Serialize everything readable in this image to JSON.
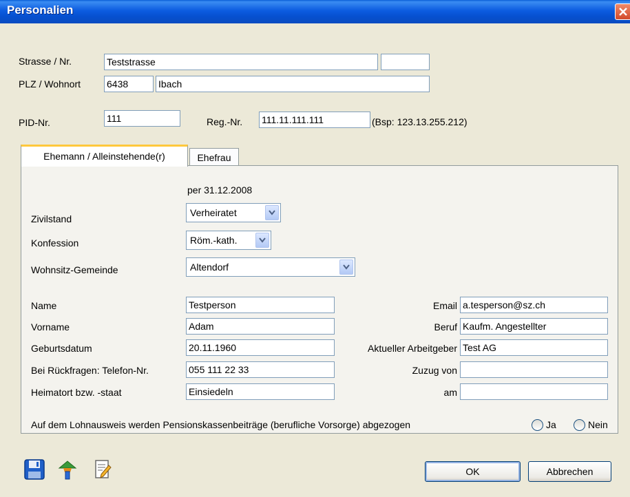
{
  "window": {
    "title": "Personalien"
  },
  "address": {
    "street_label": "Strasse / Nr.",
    "street_value": "Teststrasse",
    "number_value": "",
    "plz_label": "PLZ / Wohnort",
    "plz_value": "6438",
    "city_value": "Ibach"
  },
  "ids": {
    "pid_label": "PID-Nr.",
    "pid_value": "111",
    "reg_label": "Reg.-Nr.",
    "reg_value": "111.11.111.111",
    "reg_hint": "(Bsp: 123.13.255.212)"
  },
  "tabs": [
    {
      "label": "Ehemann / Alleinstehende(r)",
      "active": true
    },
    {
      "label": "Ehefrau",
      "active": false
    }
  ],
  "panel": {
    "date_text": "per 31.12.2008",
    "zivilstand_label": "Zivilstand",
    "zivilstand_value": "Verheiratet",
    "konfession_label": "Konfession",
    "konfession_value": "Röm.-kath.",
    "gemeinde_label": "Wohnsitz-Gemeinde",
    "gemeinde_value": "Altendorf",
    "name_label": "Name",
    "name_value": "Testperson",
    "vorname_label": "Vorname",
    "vorname_value": "Adam",
    "geburtsdatum_label": "Geburtsdatum",
    "geburtsdatum_value": "20.11.1960",
    "telefon_label": "Bei Rückfragen: Telefon-Nr.",
    "telefon_value": "055 111 22 33",
    "heimatort_label": "Heimatort bzw. -staat",
    "heimatort_value": "Einsiedeln",
    "email_label": "Email",
    "email_value": "a.tesperson@sz.ch",
    "beruf_label": "Beruf",
    "beruf_value": "Kaufm. Angestellter",
    "arbeitgeber_label": "Aktueller Arbeitgeber",
    "arbeitgeber_value": "Test AG",
    "zuzug_label": "Zuzug von",
    "zuzug_value": "",
    "am_label": "am",
    "am_value": "",
    "pension_question": "Auf dem Lohnausweis werden Pensionskassenbeiträge (berufliche Vorsorge) abgezogen",
    "ja_label": "Ja",
    "nein_label": "Nein"
  },
  "footer": {
    "ok_label": "OK",
    "cancel_label": "Abbrechen",
    "icons": [
      "save-icon",
      "import-icon",
      "edit-document-icon"
    ]
  },
  "colors": {
    "titlebar": "#0a5fd8",
    "window_bg": "#ece9d8",
    "tab_accent": "#ffc83c",
    "input_border": "#7f9db9"
  }
}
